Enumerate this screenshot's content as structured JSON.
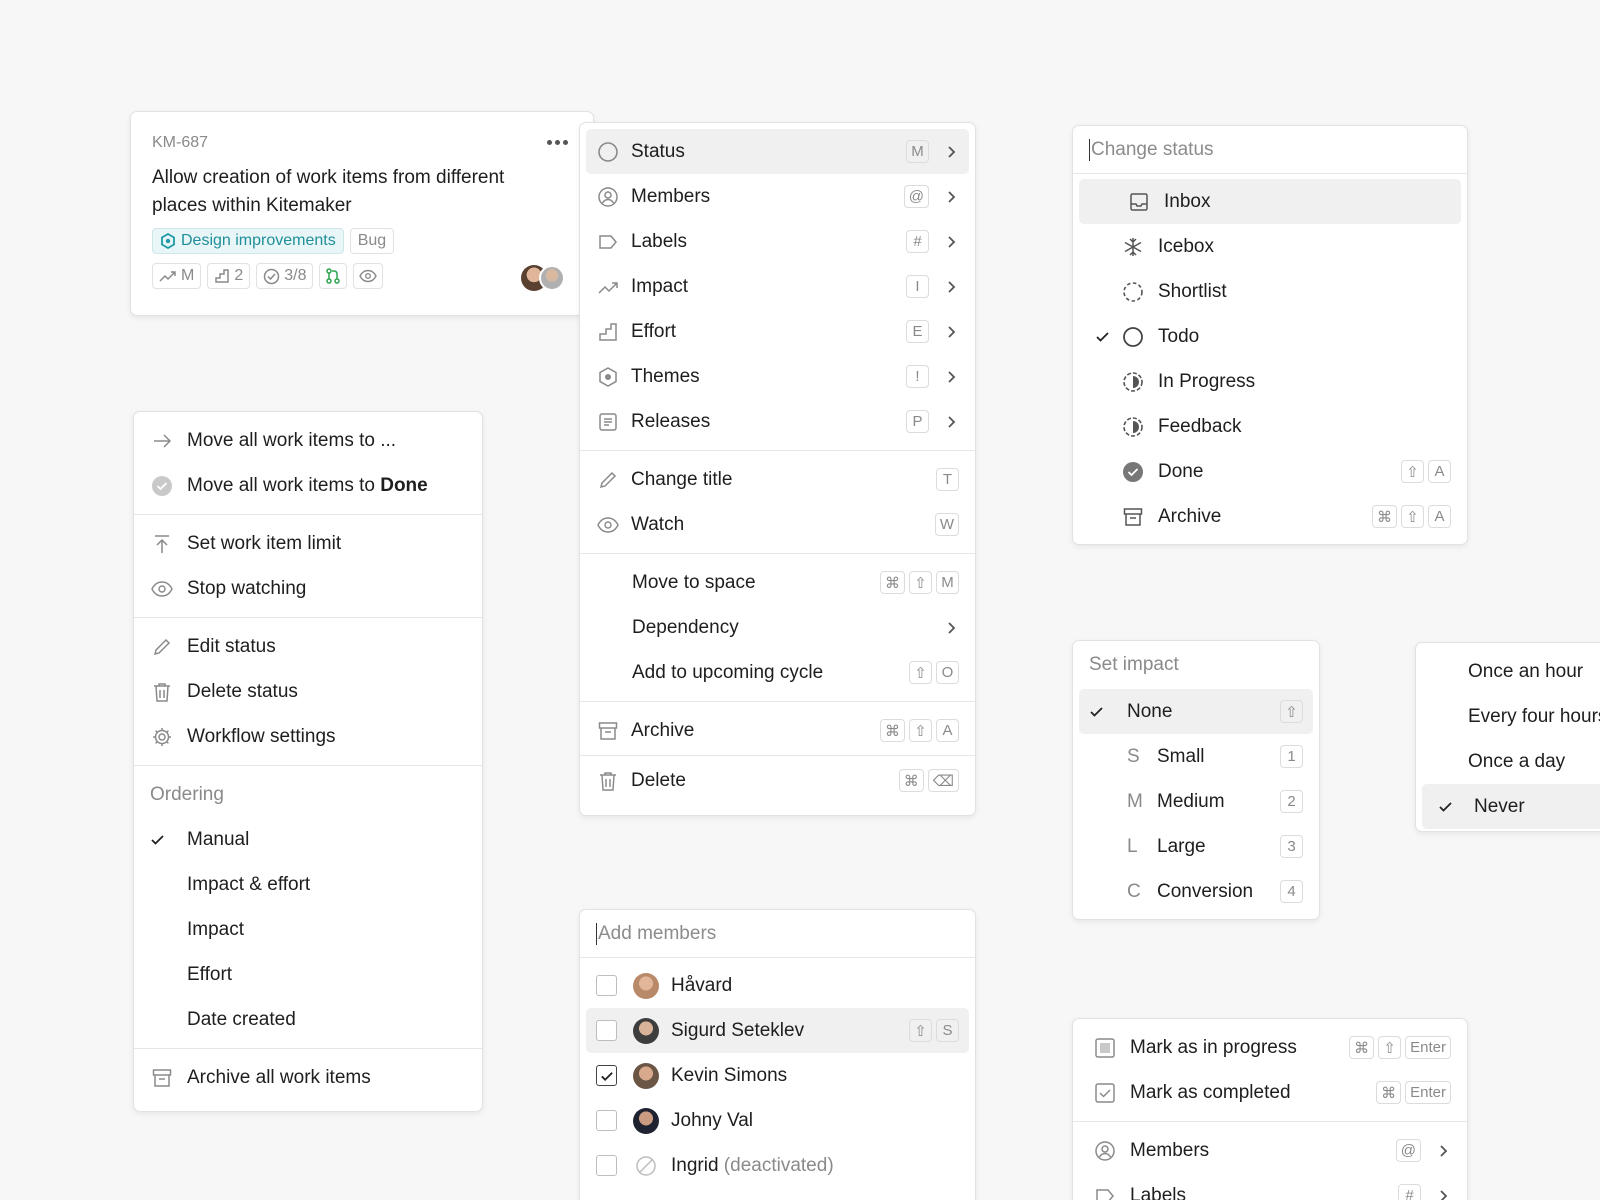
{
  "card": {
    "id": "KM-687",
    "title": "Allow creation of work items from different places within Kitemaker",
    "label_theme": "Design improvements",
    "label_bug": "Bug",
    "impact": "M",
    "effort": "2",
    "checklist": "3/8"
  },
  "context_menu": {
    "items": [
      {
        "label": "Status",
        "key": "M"
      },
      {
        "label": "Members",
        "key": "@"
      },
      {
        "label": "Labels",
        "key": "#"
      },
      {
        "label": "Impact",
        "key": "I"
      },
      {
        "label": "Effort",
        "key": "E"
      },
      {
        "label": "Themes",
        "key": "!"
      },
      {
        "label": "Releases",
        "key": "P"
      }
    ],
    "change_title": "Change title",
    "change_title_key": "T",
    "watch": "Watch",
    "watch_key": "W",
    "move_to_space": "Move to space",
    "dependency": "Dependency",
    "add_to_cycle": "Add to upcoming cycle",
    "add_to_cycle_key": "O",
    "archive": "Archive",
    "archive_key": "A",
    "delete": "Delete",
    "cmd": "⌘",
    "shift": "⇧",
    "backspace": "⌫",
    "move_key": "M"
  },
  "status_menu": {
    "placeholder": "Change status",
    "items": [
      "Inbox",
      "Icebox",
      "Shortlist",
      "Todo",
      "In Progress",
      "Feedback",
      "Done",
      "Archive"
    ],
    "key_a": "A"
  },
  "column_menu": {
    "move_to": "Move all work items to ...",
    "move_done_prefix": "Move all work items to ",
    "move_done_bold": "Done",
    "set_limit": "Set work item limit",
    "stop_watching": "Stop watching",
    "edit_status": "Edit status",
    "delete_status": "Delete status",
    "workflow_settings": "Workflow settings",
    "ordering_header": "Ordering",
    "ordering": [
      "Manual",
      "Impact & effort",
      "Impact",
      "Effort",
      "Date created"
    ],
    "archive_all": "Archive all work items"
  },
  "impact_menu": {
    "title": "Set impact",
    "items": [
      {
        "letter": "",
        "label": "None",
        "key": "⇧"
      },
      {
        "letter": "S",
        "label": "Small",
        "key": "1"
      },
      {
        "letter": "M",
        "label": "Medium",
        "key": "2"
      },
      {
        "letter": "L",
        "label": "Large",
        "key": "3"
      },
      {
        "letter": "C",
        "label": "Conversion",
        "key": "4"
      }
    ]
  },
  "frequency_menu": {
    "items": [
      "Once an hour",
      "Every four hours",
      "Once a day",
      "Never"
    ]
  },
  "members_menu": {
    "placeholder": "Add members",
    "members": [
      {
        "name": "Håvard",
        "suffix": ""
      },
      {
        "name": "Sigurd Seteklev",
        "suffix": ""
      },
      {
        "name": "Kevin Simons",
        "suffix": ""
      },
      {
        "name": "Johny Val",
        "suffix": ""
      },
      {
        "name": "Ingrid",
        "suffix": " (deactivated)"
      }
    ],
    "sigurd_key": "S"
  },
  "todo_menu": {
    "mark_in_progress": "Mark as in progress",
    "mark_completed": "Mark as completed",
    "enter": "Enter",
    "members": "Members",
    "members_key": "@",
    "labels": "Labels",
    "labels_key": "#"
  },
  "colors": {
    "teal": "#1f9aa6",
    "green": "#2ea44f",
    "muted": "#8a8a8a"
  }
}
